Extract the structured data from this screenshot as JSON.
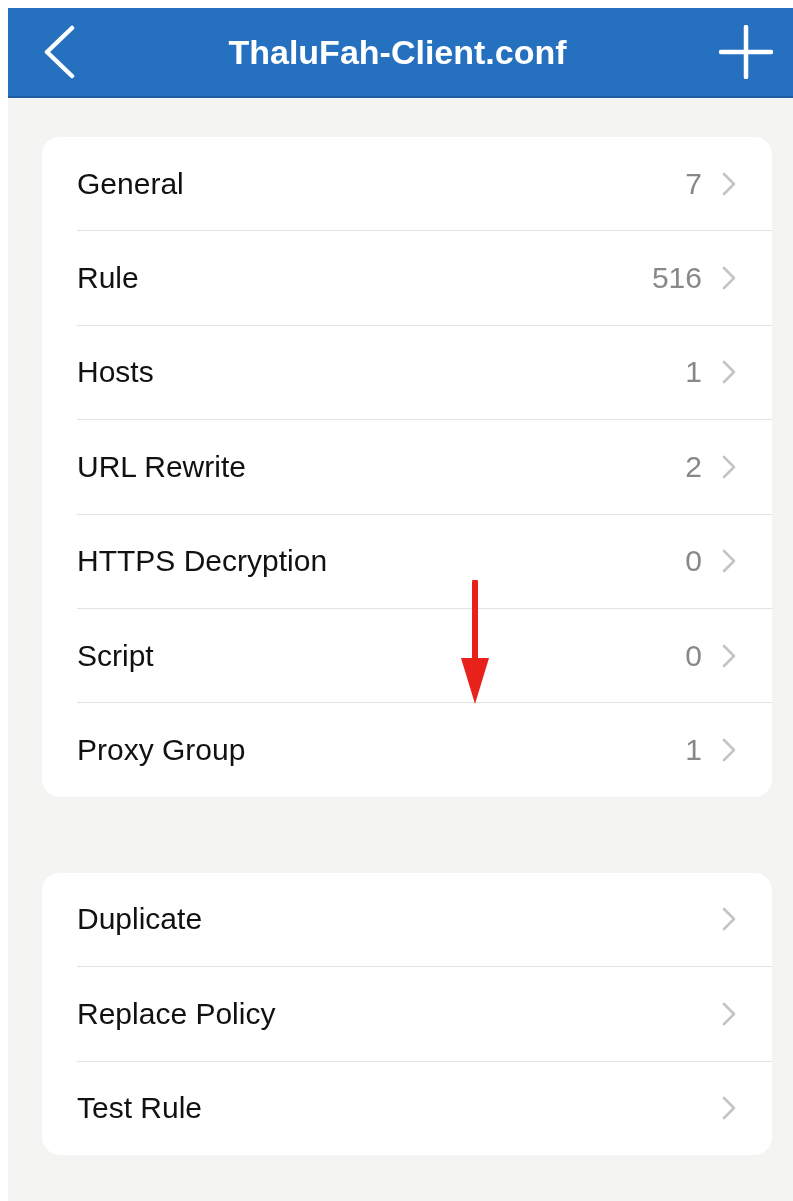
{
  "nav_bar": {
    "title": "ThaluFah-Client.conf"
  },
  "sections": [
    {
      "items": [
        {
          "label": "General",
          "count": "7"
        },
        {
          "label": "Rule",
          "count": "516"
        },
        {
          "label": "Hosts",
          "count": "1"
        },
        {
          "label": "URL Rewrite",
          "count": "2"
        },
        {
          "label": "HTTPS Decryption",
          "count": "0"
        },
        {
          "label": "Script",
          "count": "0"
        },
        {
          "label": "Proxy Group",
          "count": "1"
        }
      ]
    },
    {
      "items": [
        {
          "label": "Duplicate"
        },
        {
          "label": "Replace Policy"
        },
        {
          "label": "Test Rule"
        }
      ]
    }
  ]
}
